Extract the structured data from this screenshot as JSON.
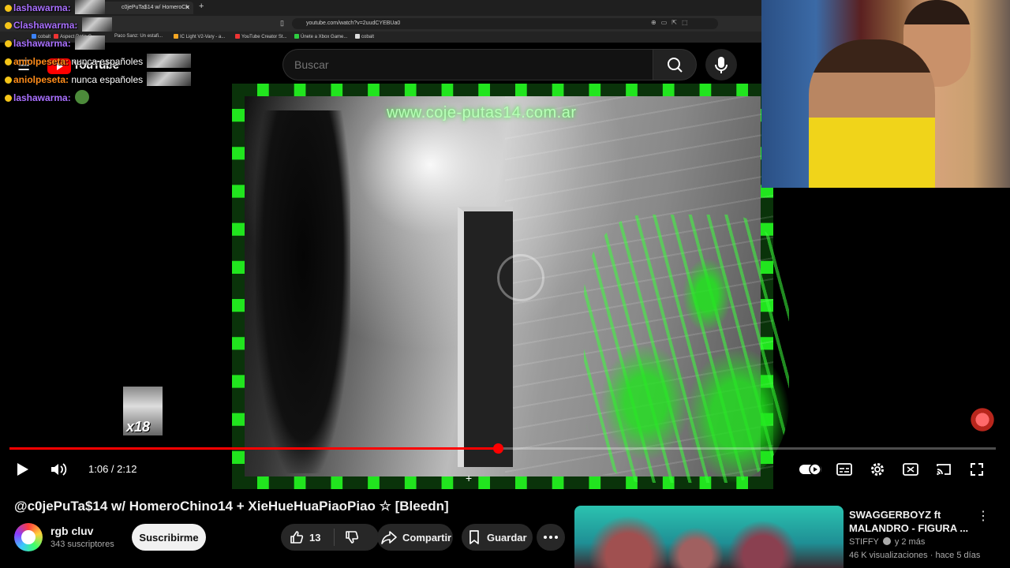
{
  "browser": {
    "tab_title": "c0jePuTa$14 w/ HomeroCh",
    "address": "youtube.com/watch?v=2uudCYEBUa0",
    "bookmarks": [
      "cobalt",
      "Aspect Ratio C...",
      "Paco Sanz: Un estafi...",
      "IC Light V2-Vary - a...",
      "YouTube Creator St...",
      "Únete a Xbox Game...",
      "cobalt"
    ]
  },
  "chat": [
    {
      "user": "lashawarma:",
      "message": "",
      "color": "#a970ff"
    },
    {
      "user": "Clashawarma:",
      "message": "",
      "color": "#a970ff"
    },
    {
      "user": "lashawarma:",
      "message": "",
      "color": "#a970ff"
    },
    {
      "user": "aniolpeseta:",
      "message": "nunca españoles",
      "color": "#ff8c1a"
    },
    {
      "user": "aniolpeseta:",
      "message": "nunca españoles",
      "color": "#ff8c1a"
    },
    {
      "user": "lashawarma:",
      "message": "",
      "color": "#a970ff"
    }
  ],
  "youtube": {
    "logo_text": "YouTube",
    "search_placeholder": "Buscar"
  },
  "video": {
    "overlay_url": "www.coje-putas14.com.ar",
    "current_time": "1:06",
    "duration": "2:12",
    "time_display": "1:06 / 2:12",
    "progress_fraction": 0.495,
    "title": "@c0jePuTa$14 w/ HomeroChino14 + XieHueHuaPiaoPiao ☆ [Bleedn]"
  },
  "stream_overlay": {
    "thumb_label": "x18"
  },
  "channel": {
    "name": "rgb cluv",
    "subscribers": "343 suscriptores",
    "subscribe_label": "Suscribirme"
  },
  "actions": {
    "likes": "13",
    "share_label": "Compartir",
    "save_label": "Guardar"
  },
  "recommended": {
    "title": "SWAGGERBOYZ ft MALANDRO - FIGURA ...",
    "channel": "STIFFY",
    "extra": "y 2 más",
    "meta": "46 K visualizaciones · hace 5 días"
  },
  "colors": {
    "progress": "#ff0000",
    "frame_green": "#21e51e",
    "background": "#000000"
  }
}
